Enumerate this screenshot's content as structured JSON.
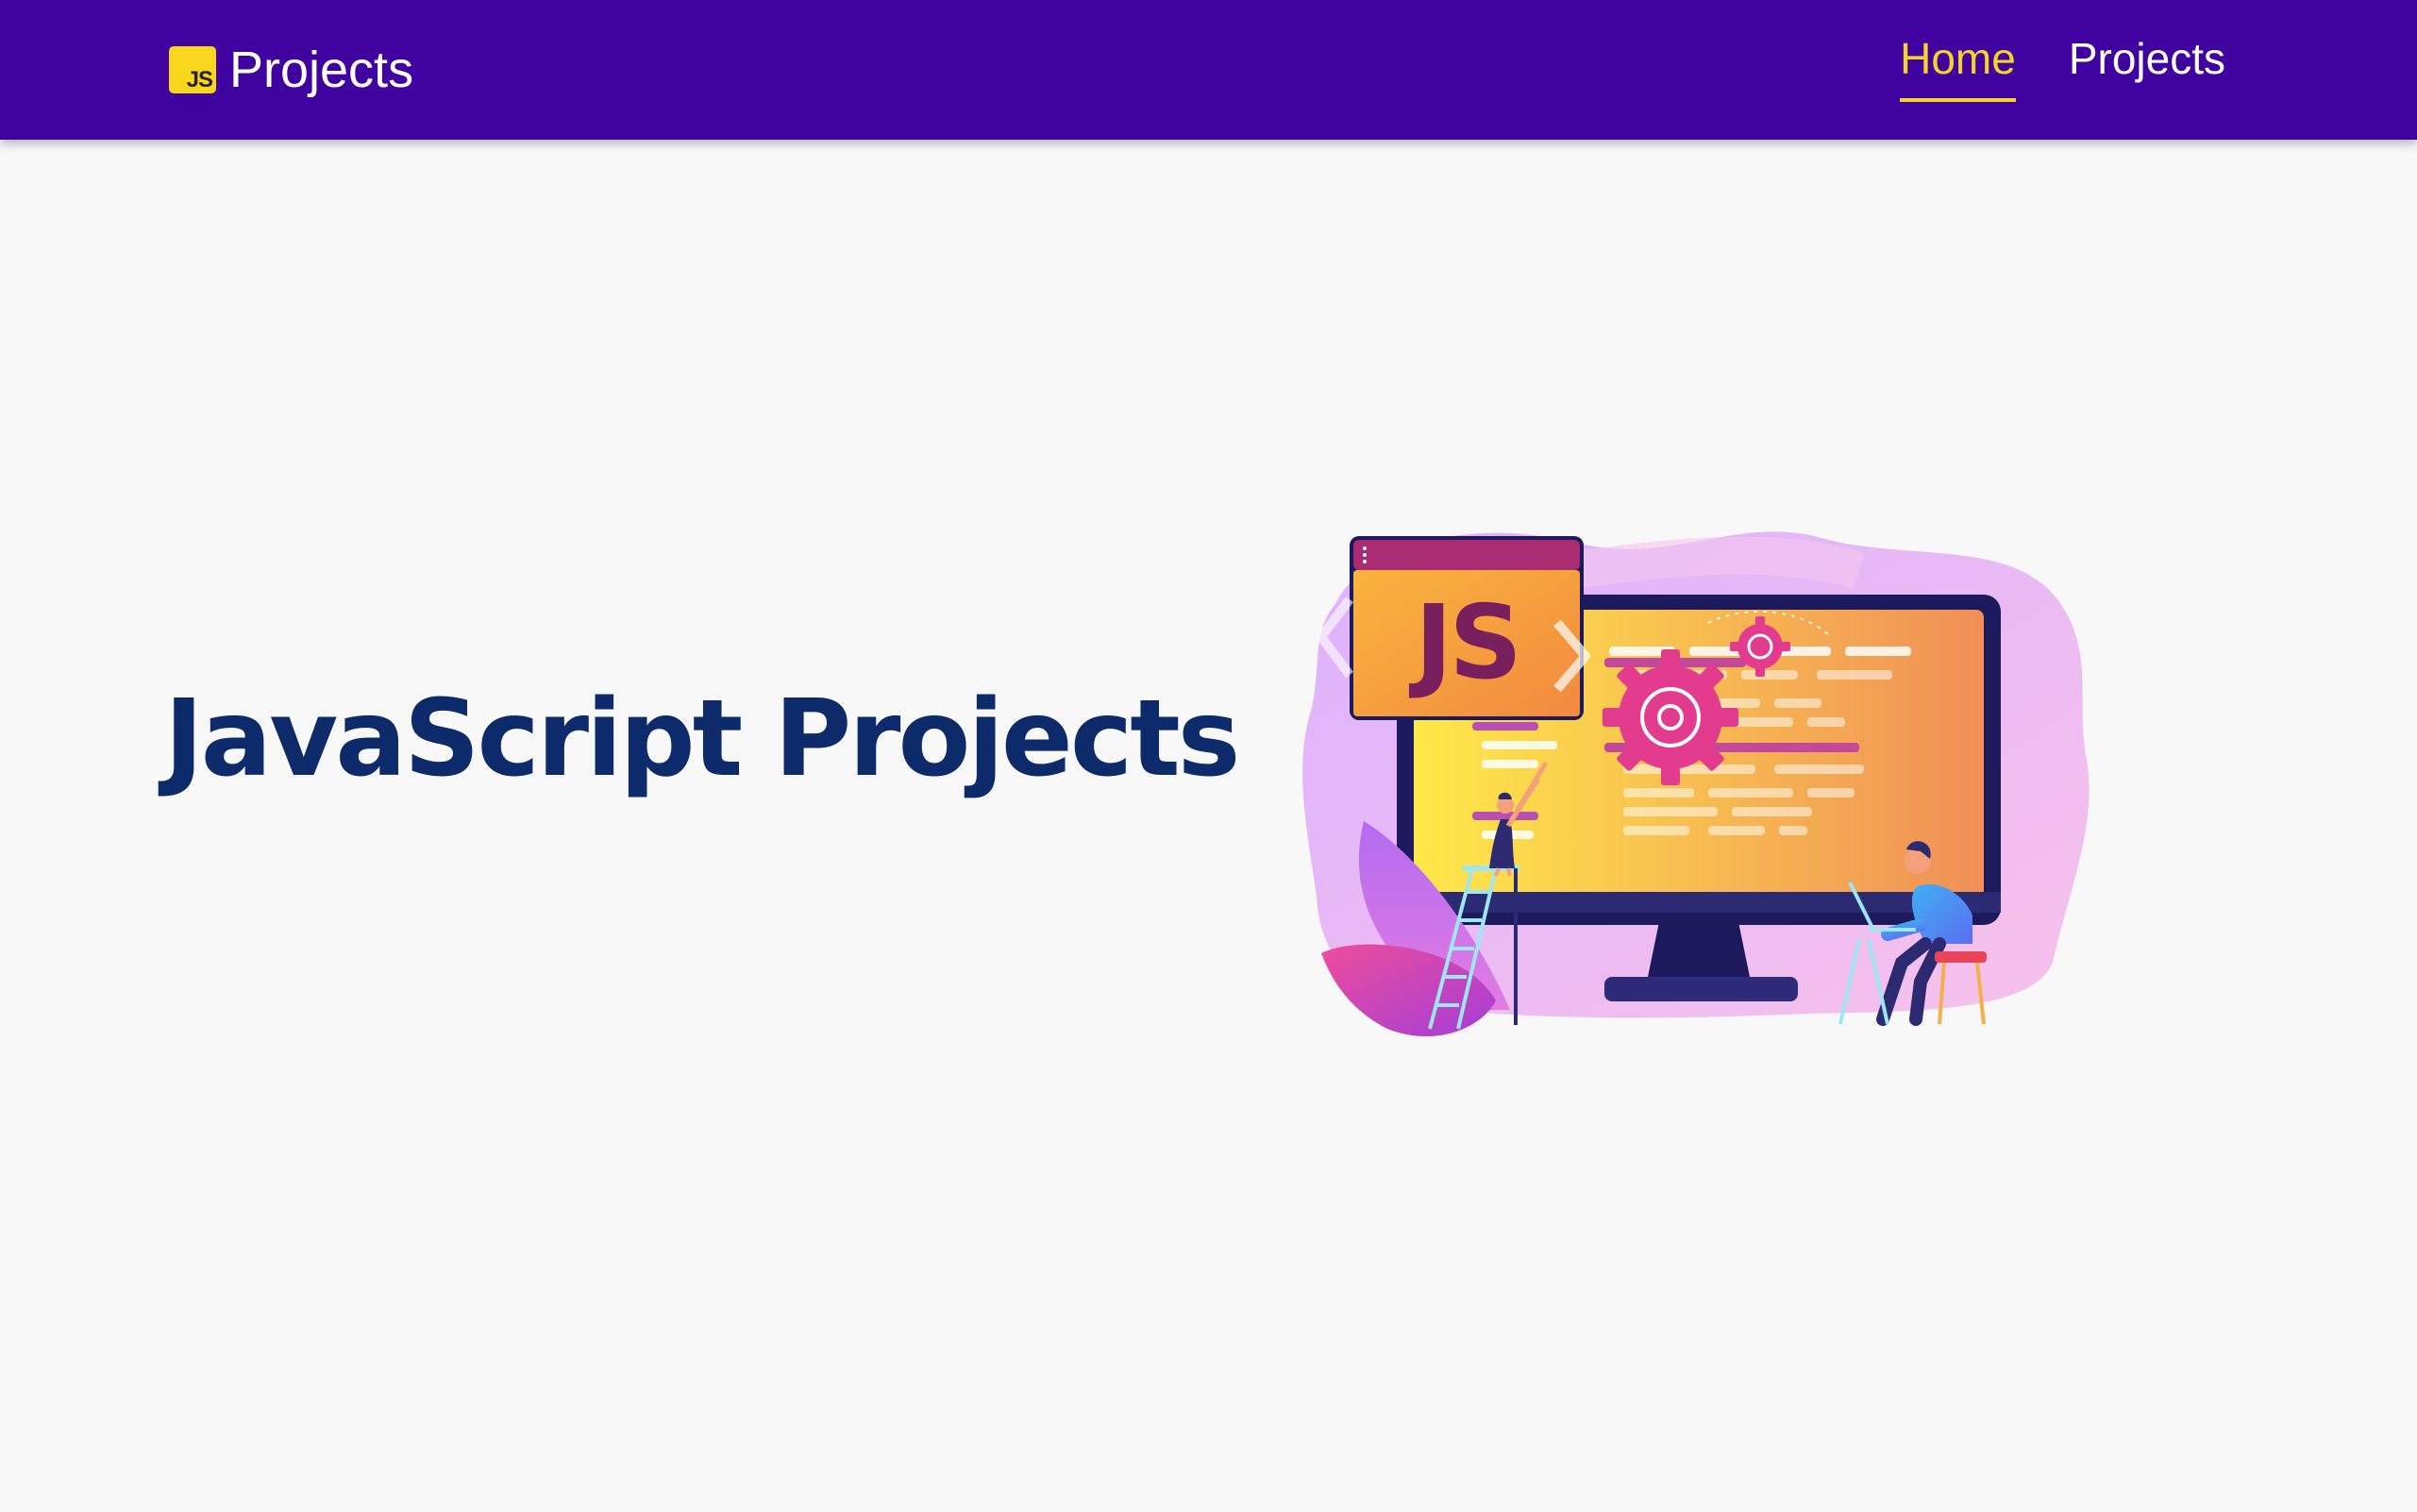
{
  "nav": {
    "brand_badge": "JS",
    "brand_text": "Projects",
    "links": [
      {
        "label": "Home",
        "active": true
      },
      {
        "label": "Projects",
        "active": false
      }
    ]
  },
  "hero": {
    "title": "JavaScript Projects",
    "illustration_badge": "JS"
  },
  "colors": {
    "navbar": "#4003a0",
    "active_link": "#f5d328",
    "title": "#0d2a6a",
    "background": "#f8f8f8"
  }
}
